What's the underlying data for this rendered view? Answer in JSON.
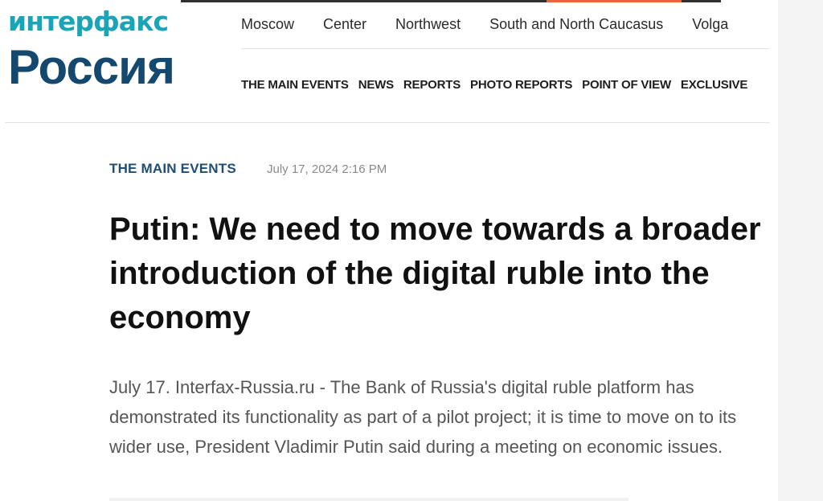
{
  "logo": {
    "top_text": "интерфакс",
    "bottom_text": "Россия"
  },
  "regions": [
    "Moscow",
    "Center",
    "Northwest",
    "South and North Caucasus",
    "Volga"
  ],
  "sections": [
    "THE MAIN EVENTS",
    "NEWS",
    "REPORTS",
    "PHOTO REPORTS",
    "POINT OF VIEW",
    "EXCLUSIVE"
  ],
  "article": {
    "category": "THE MAIN EVENTS",
    "timestamp": "July 17, 2024 2:16 PM",
    "headline": "Putin: We need to move towards a broader introduction of the digital ruble into the economy",
    "lead": "July 17. Interfax-Russia.ru - The Bank of Russia's digital ruble platform has demonstrated its functionality as part of a pilot project; it is time to move on to its wider use, President Vladimir Putin said during a meeting on economic issues."
  },
  "colors": {
    "logo_teal": "#1aa4b8",
    "logo_navy": "#14486e",
    "category_blue": "#1f4e72",
    "accent_orange": "#e8643a"
  }
}
